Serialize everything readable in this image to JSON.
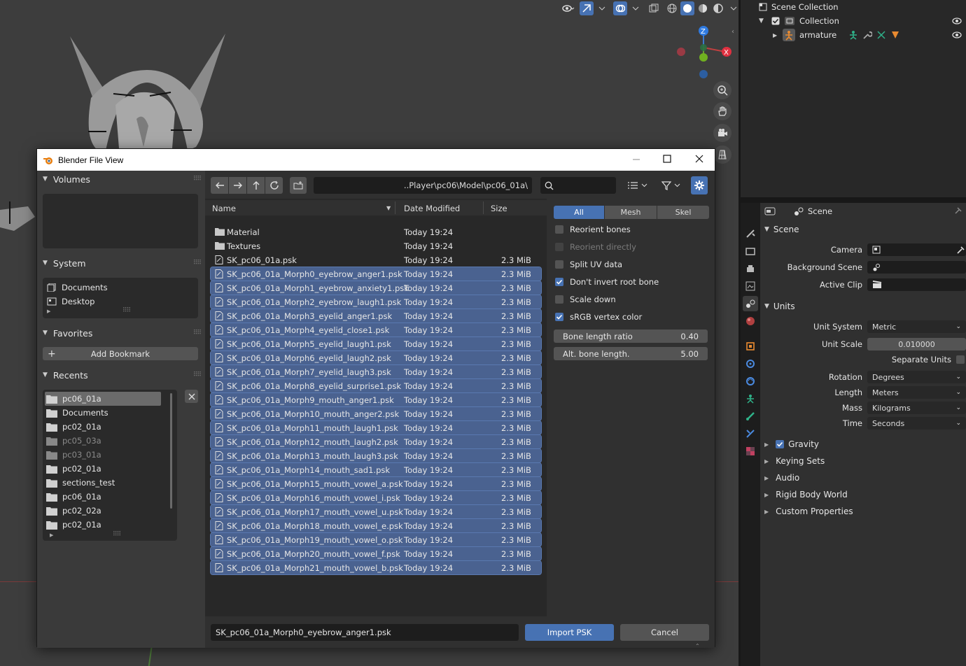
{
  "viewport": {},
  "outliner": {
    "rows": [
      "Scene Collection",
      "Collection",
      "armature"
    ]
  },
  "properties": {
    "header_title": "Scene",
    "scene_section": "Scene",
    "camera_label": "Camera",
    "background_scene_label": "Background Scene",
    "active_clip_label": "Active Clip",
    "units_section": "Units",
    "unit_system_label": "Unit System",
    "unit_system_value": "Metric",
    "unit_scale_label": "Unit Scale",
    "unit_scale_value": "0.010000",
    "separate_units_label": "Separate Units",
    "rotation_label": "Rotation",
    "rotation_value": "Degrees",
    "length_label": "Length",
    "length_value": "Meters",
    "mass_label": "Mass",
    "mass_value": "Kilograms",
    "time_label": "Time",
    "time_value": "Seconds",
    "gravity_label": "Gravity",
    "keying_sets_label": "Keying Sets",
    "audio_label": "Audio",
    "rigid_body_world_label": "Rigid Body World",
    "custom_properties_label": "Custom Properties"
  },
  "dialog": {
    "title": "Blender File View",
    "sidebar": {
      "volumes": "Volumes",
      "system": "System",
      "system_items": [
        "Documents",
        "Desktop"
      ],
      "favorites": "Favorites",
      "add_bookmark": "Add Bookmark",
      "recents": "Recents",
      "recent_items": [
        "pc06_01a",
        "Documents",
        "pc02_01a",
        "pc05_03a",
        "pc03_01a",
        "pc02_01a",
        "sections_test",
        "pc06_01a",
        "pc02_02a",
        "pc02_01a"
      ]
    },
    "path": "..Player\\pc06\\Model\\pc06_01a\\",
    "columns": {
      "name": "Name",
      "date": "Date Modified",
      "size": "Size"
    },
    "files": [
      {
        "name": "Material",
        "date": "Today 19:24",
        "size": ""
      },
      {
        "name": "Textures",
        "date": "Today 19:24",
        "size": ""
      },
      {
        "name": "SK_pc06_01a.psk",
        "date": "Today 19:24",
        "size": "2.3 MiB"
      },
      {
        "name": "SK_pc06_01a_Morph0_eyebrow_anger1.psk",
        "date": "Today 19:24",
        "size": "2.3 MiB"
      },
      {
        "name": "SK_pc06_01a_Morph1_eyebrow_anxiety1.psk",
        "date": "Today 19:24",
        "size": "2.3 MiB"
      },
      {
        "name": "SK_pc06_01a_Morph2_eyebrow_laugh1.psk",
        "date": "Today 19:24",
        "size": "2.3 MiB"
      },
      {
        "name": "SK_pc06_01a_Morph3_eyelid_anger1.psk",
        "date": "Today 19:24",
        "size": "2.3 MiB"
      },
      {
        "name": "SK_pc06_01a_Morph4_eyelid_close1.psk",
        "date": "Today 19:24",
        "size": "2.3 MiB"
      },
      {
        "name": "SK_pc06_01a_Morph5_eyelid_laugh1.psk",
        "date": "Today 19:24",
        "size": "2.3 MiB"
      },
      {
        "name": "SK_pc06_01a_Morph6_eyelid_laugh2.psk",
        "date": "Today 19:24",
        "size": "2.3 MiB"
      },
      {
        "name": "SK_pc06_01a_Morph7_eyelid_laugh3.psk",
        "date": "Today 19:24",
        "size": "2.3 MiB"
      },
      {
        "name": "SK_pc06_01a_Morph8_eyelid_surprise1.psk",
        "date": "Today 19:24",
        "size": "2.3 MiB"
      },
      {
        "name": "SK_pc06_01a_Morph9_mouth_anger1.psk",
        "date": "Today 19:24",
        "size": "2.3 MiB"
      },
      {
        "name": "SK_pc06_01a_Morph10_mouth_anger2.psk",
        "date": "Today 19:24",
        "size": "2.3 MiB"
      },
      {
        "name": "SK_pc06_01a_Morph11_mouth_laugh1.psk",
        "date": "Today 19:24",
        "size": "2.3 MiB"
      },
      {
        "name": "SK_pc06_01a_Morph12_mouth_laugh2.psk",
        "date": "Today 19:24",
        "size": "2.3 MiB"
      },
      {
        "name": "SK_pc06_01a_Morph13_mouth_laugh3.psk",
        "date": "Today 19:24",
        "size": "2.3 MiB"
      },
      {
        "name": "SK_pc06_01a_Morph14_mouth_sad1.psk",
        "date": "Today 19:24",
        "size": "2.3 MiB"
      },
      {
        "name": "SK_pc06_01a_Morph15_mouth_vowel_a.psk",
        "date": "Today 19:24",
        "size": "2.3 MiB"
      },
      {
        "name": "SK_pc06_01a_Morph16_mouth_vowel_i.psk",
        "date": "Today 19:24",
        "size": "2.3 MiB"
      },
      {
        "name": "SK_pc06_01a_Morph17_mouth_vowel_u.psk",
        "date": "Today 19:24",
        "size": "2.3 MiB"
      },
      {
        "name": "SK_pc06_01a_Morph18_mouth_vowel_e.psk",
        "date": "Today 19:24",
        "size": "2.3 MiB"
      },
      {
        "name": "SK_pc06_01a_Morph19_mouth_vowel_o.psk",
        "date": "Today 19:24",
        "size": "2.3 MiB"
      },
      {
        "name": "SK_pc06_01a_Morph20_mouth_vowel_f.psk",
        "date": "Today 19:24",
        "size": "2.3 MiB"
      },
      {
        "name": "SK_pc06_01a_Morph21_mouth_vowel_b.psk",
        "date": "Today 19:24",
        "size": "2.3 MiB"
      }
    ],
    "options": {
      "tabs": [
        "All",
        "Mesh",
        "Skel"
      ],
      "checkboxes": [
        {
          "label": "Reorient bones",
          "checked": false
        },
        {
          "label": "Reorient directly",
          "checked": false
        },
        {
          "label": "Split UV data",
          "checked": false
        },
        {
          "label": "Don't invert root bone",
          "checked": true
        },
        {
          "label": "Scale down",
          "checked": false
        },
        {
          "label": "sRGB vertex color",
          "checked": true
        }
      ],
      "bone_length_ratio_label": "Bone length ratio",
      "bone_length_ratio_value": "0.40",
      "alt_bone_length_label": "Alt. bone length.",
      "alt_bone_length_value": "5.00"
    },
    "filename": "SK_pc06_01a_Morph0_eyebrow_anger1.psk",
    "import_label": "Import PSK",
    "cancel_label": "Cancel"
  },
  "colors": {
    "accent": "#4772b3",
    "selection": "#4a6290"
  }
}
